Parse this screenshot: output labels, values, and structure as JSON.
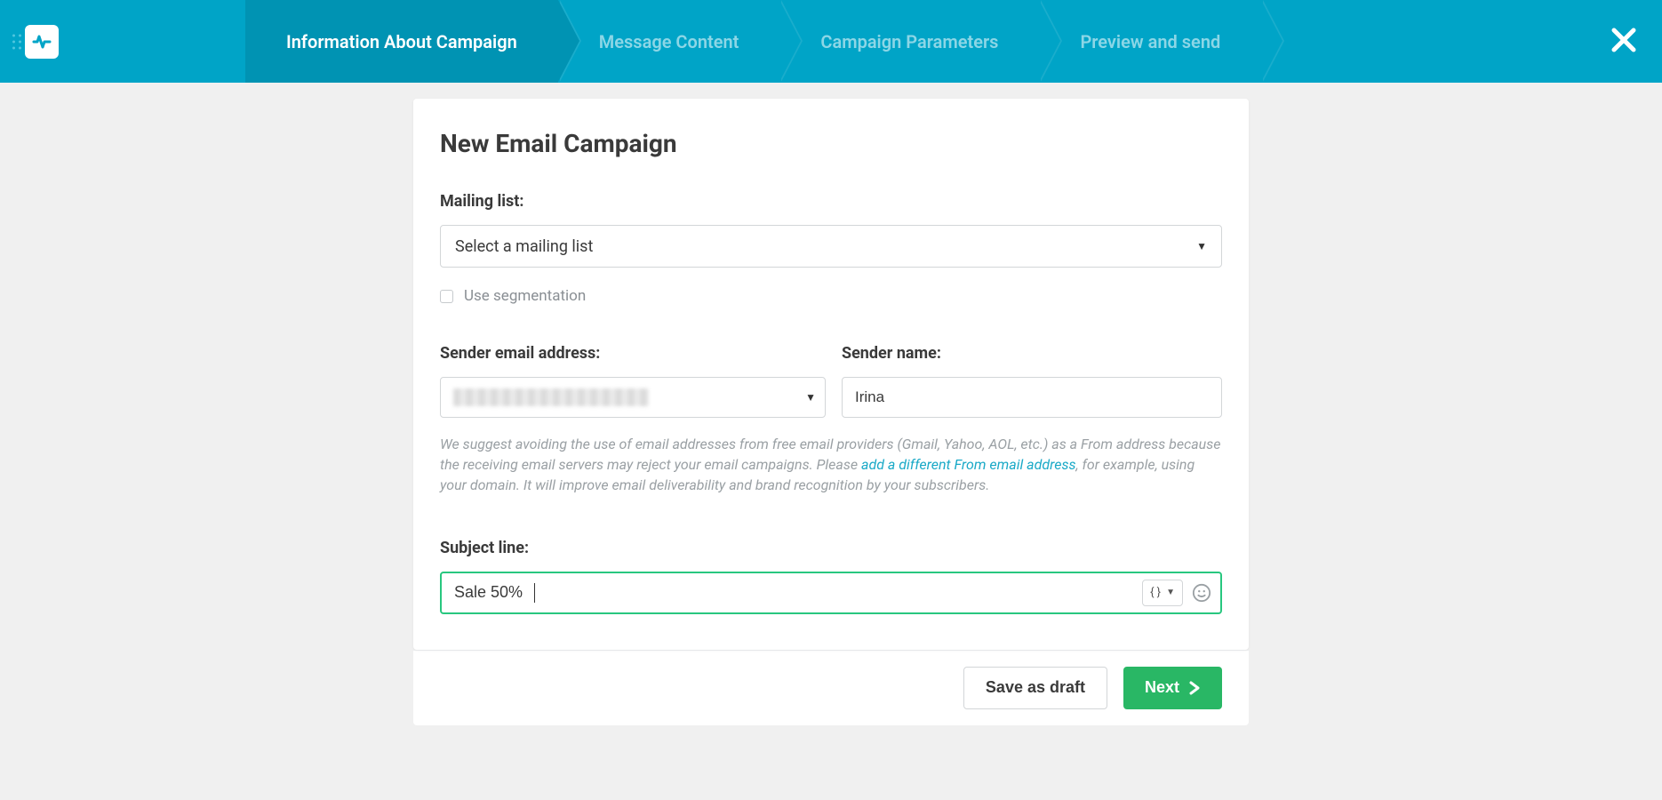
{
  "header": {
    "steps": [
      {
        "label": "Information About Campaign",
        "active": true
      },
      {
        "label": "Message Content",
        "active": false
      },
      {
        "label": "Campaign Parameters",
        "active": false
      },
      {
        "label": "Preview and send",
        "active": false
      }
    ]
  },
  "page": {
    "title": "New Email Campaign",
    "mailing_list": {
      "label": "Mailing list:",
      "placeholder": "Select a mailing list",
      "segmentation_label": "Use segmentation"
    },
    "sender_email": {
      "label": "Sender email address:"
    },
    "sender_name": {
      "label": "Sender name:",
      "value": "Irina"
    },
    "helper": {
      "part1": "We suggest avoiding the use of email addresses from free email providers (Gmail, Yahoo, AOL, etc.) as a From address because the receiving email servers may reject your email campaigns. Please ",
      "link": "add a different From email address",
      "part2": ", for example, using your domain. It will improve email deliverability and brand recognition by your subscribers."
    },
    "subject": {
      "label": "Subject line:",
      "value": "Sale 50%",
      "var_symbol": "{ }"
    }
  },
  "footer": {
    "save_draft": "Save as draft",
    "next": "Next"
  }
}
